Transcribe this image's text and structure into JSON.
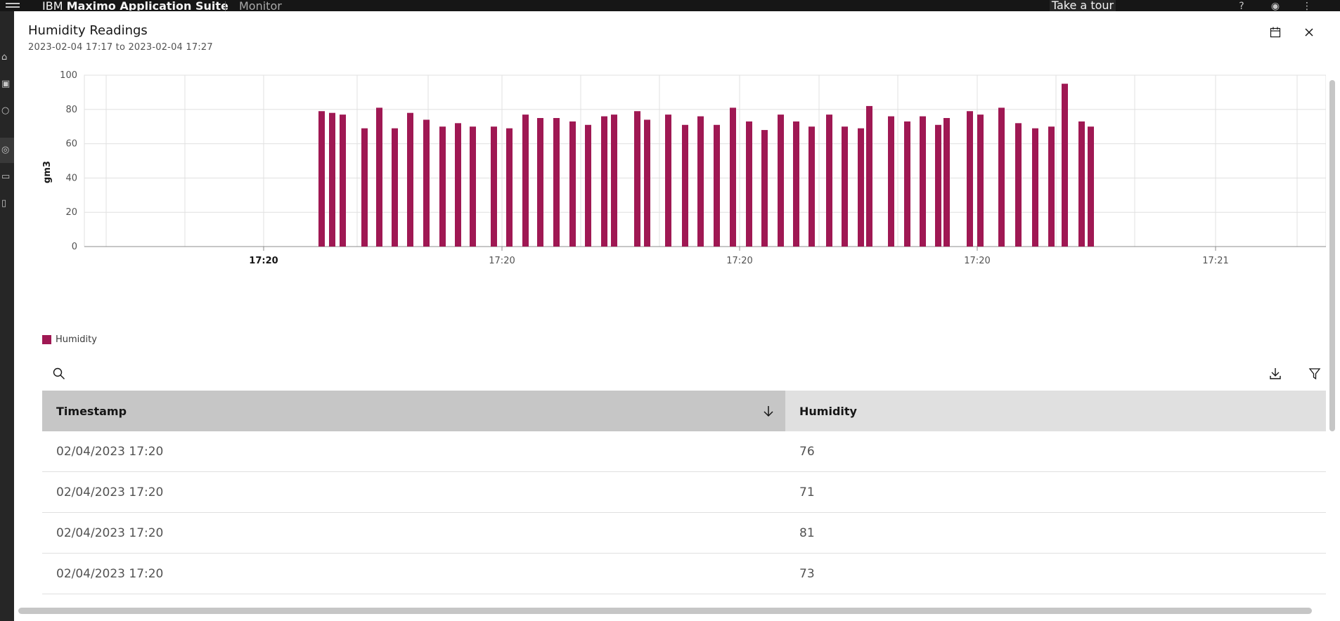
{
  "app": {
    "name_prefix": "IBM ",
    "name_bold": "Maximo Application Suite",
    "section": "Monitor",
    "tour_label": "Take a tour"
  },
  "modal": {
    "title": "Humidity Readings",
    "subtitle": "2023-02-04 17:17 to 2023-02-04 17:27",
    "calendar_icon": "calendar-icon",
    "close_icon": "close-icon"
  },
  "chart_data": {
    "type": "bar",
    "ylabel": "gm3",
    "ylim": [
      0,
      100
    ],
    "yticks": [
      "0",
      "20",
      "40",
      "60",
      "80",
      "100"
    ],
    "xticks": [
      "17:20",
      "17:20",
      "17:20",
      "17:20",
      "17:21"
    ],
    "grid": true,
    "legend_position": "bottom-left",
    "series": [
      {
        "name": "Humidity",
        "color": "#9f1853",
        "values": [
          79,
          78,
          77,
          69,
          81,
          69,
          78,
          74,
          70,
          72,
          70,
          70,
          69,
          77,
          75,
          75,
          73,
          71,
          76,
          77,
          79,
          74,
          77,
          71,
          76,
          71,
          81,
          73,
          68,
          77,
          73,
          70,
          77,
          70,
          69,
          82,
          76,
          73,
          76,
          71,
          75,
          79,
          77,
          81,
          72,
          69,
          70,
          95,
          73,
          70
        ]
      }
    ]
  },
  "legend": {
    "label": "Humidity"
  },
  "toolbar": {
    "search_icon": "search-icon",
    "download_icon": "download-icon",
    "filter_icon": "filter-icon"
  },
  "table": {
    "headers": {
      "timestamp": "Timestamp",
      "humidity": "Humidity"
    },
    "rows": [
      {
        "timestamp": "02/04/2023 17:20",
        "humidity": "76"
      },
      {
        "timestamp": "02/04/2023 17:20",
        "humidity": "71"
      },
      {
        "timestamp": "02/04/2023 17:20",
        "humidity": "81"
      },
      {
        "timestamp": "02/04/2023 17:20",
        "humidity": "73"
      }
    ]
  }
}
